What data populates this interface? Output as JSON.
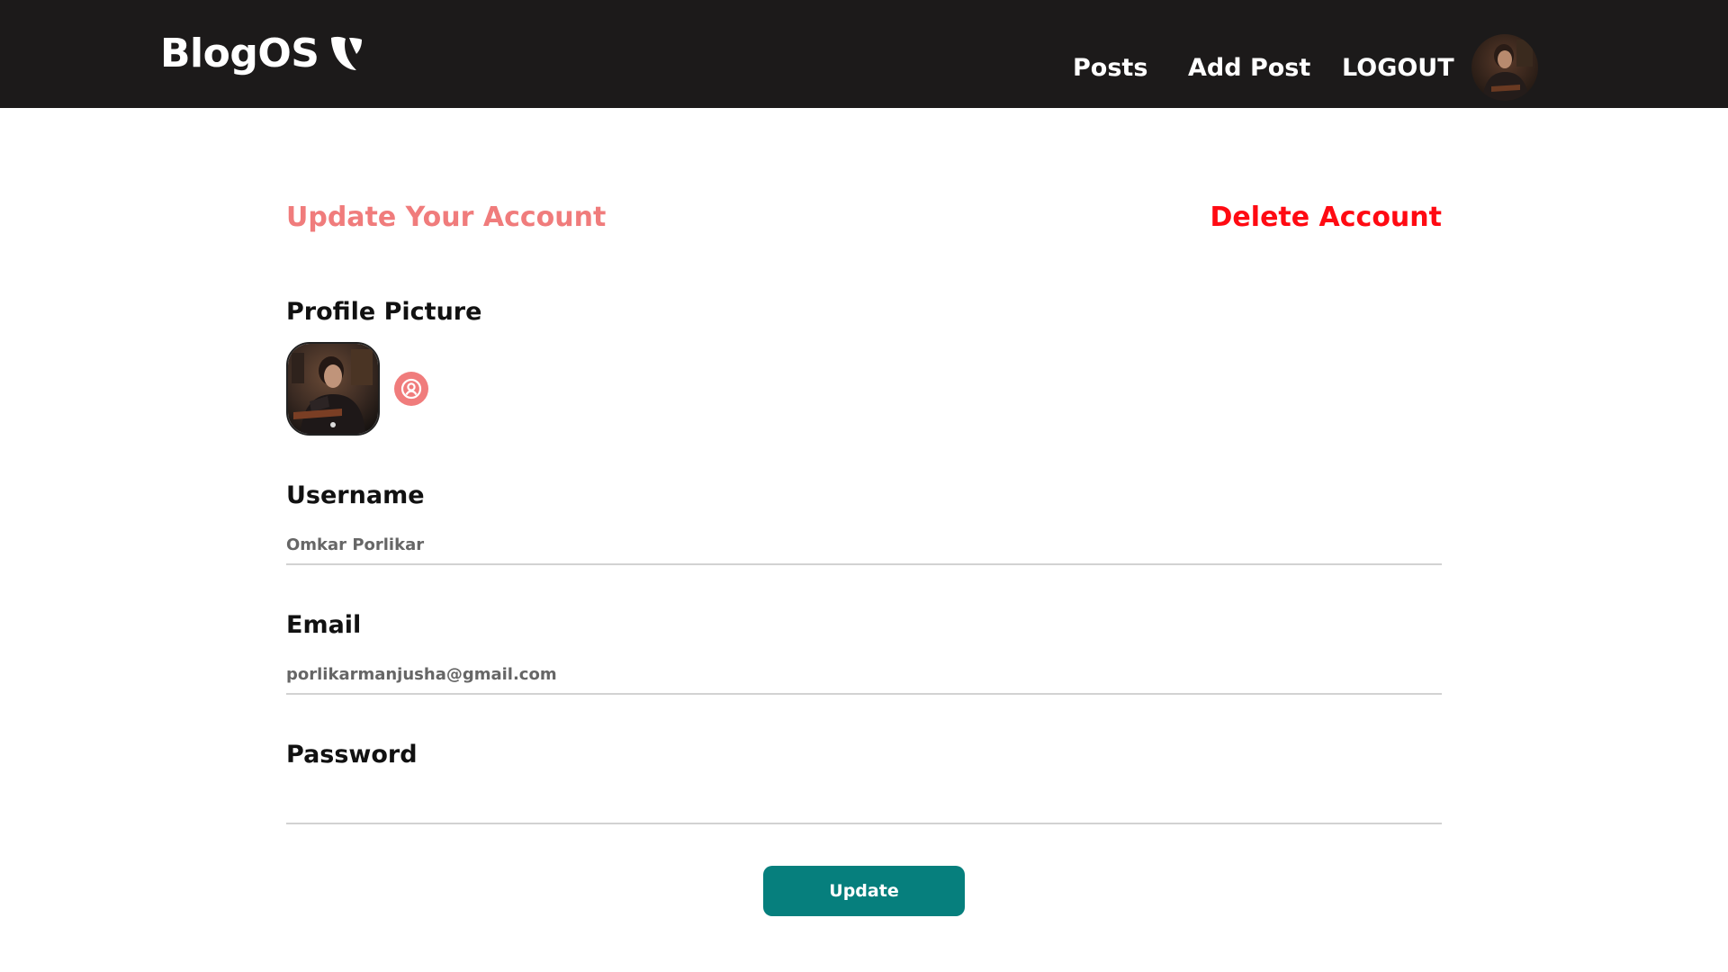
{
  "header": {
    "brand": "BlogOS",
    "brand_icon": "typo3-logo-icon",
    "nav": {
      "posts": "Posts",
      "add_post": "Add Post",
      "logout": "LOGOUT"
    },
    "avatar": "user-avatar-photo"
  },
  "main": {
    "title": "Update Your Account",
    "delete_label": "Delete Account",
    "profile_picture": {
      "label": "Profile Picture",
      "upload_icon": "user-circle-icon"
    },
    "username": {
      "label": "Username",
      "value": "Omkar Porlikar"
    },
    "email": {
      "label": "Email",
      "value": "porlikarmanjusha@gmail.com"
    },
    "password": {
      "label": "Password",
      "value": ""
    },
    "update_label": "Update"
  },
  "colors": {
    "navbar_bg": "#1c1a1a",
    "title": "#f07c7c",
    "delete": "#ff0a12",
    "button": "#067f7d"
  }
}
